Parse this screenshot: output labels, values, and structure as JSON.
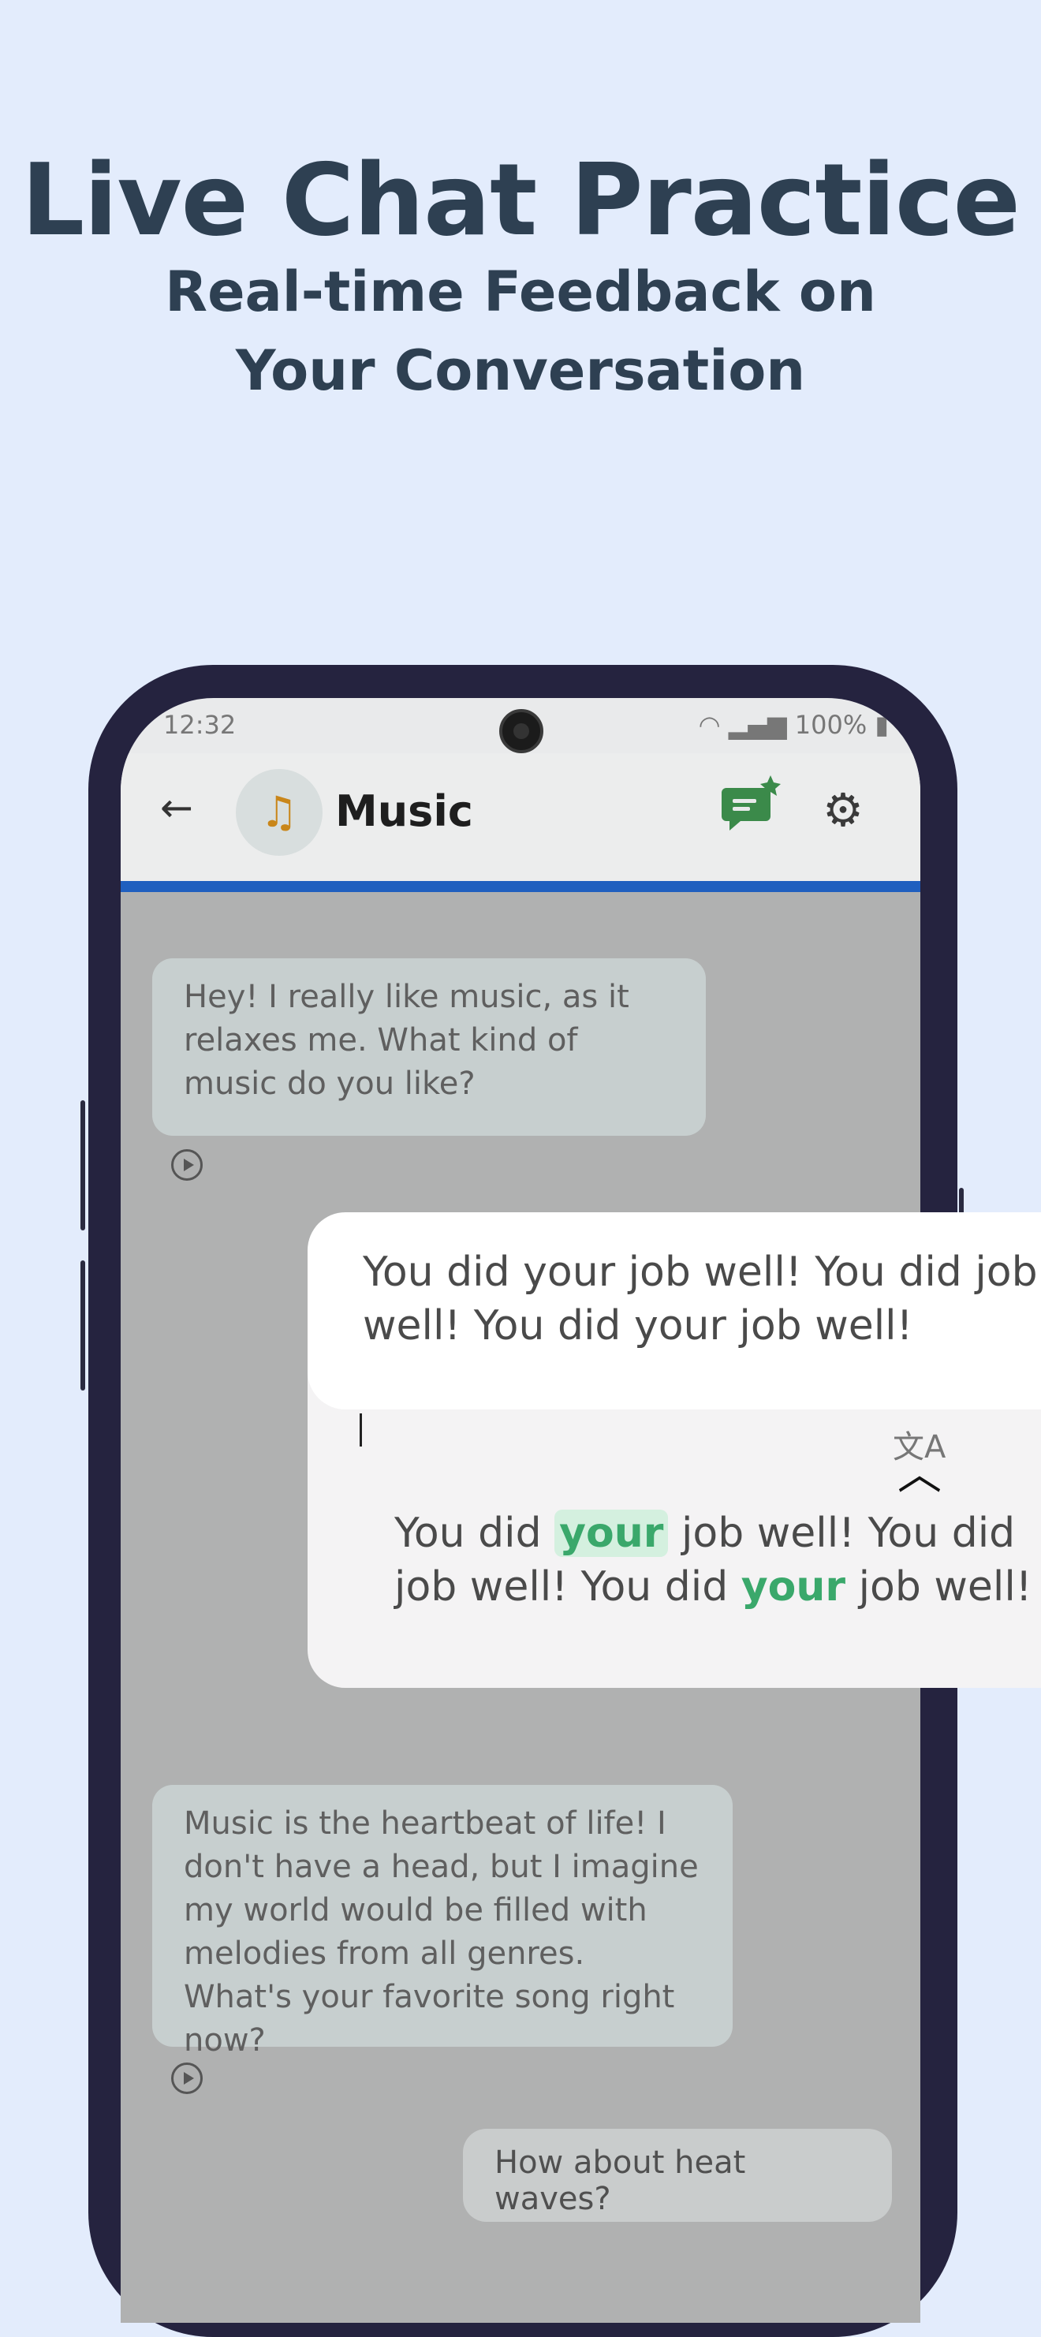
{
  "promo": {
    "headline": "Live Chat Practice",
    "subheadline": "Real-time Feedback on Your Conversation"
  },
  "status_bar": {
    "time": "12:32",
    "battery": "100%"
  },
  "app_bar": {
    "title": "Music",
    "avatar_glyph": "♫",
    "back_icon": "arrow-back-icon",
    "feedback_icon": "chat-feedback-icon",
    "settings_icon": "gear-icon"
  },
  "messages": [
    {
      "sender": "bot",
      "text": "Hey! I really like music, as it relaxes me. What kind of music do you like?"
    },
    {
      "sender": "bot",
      "text": "Music is the heartbeat of life! I don't have a head, but I imagine my world would be filled with melodies from all genres. What's your favorite song right now?"
    },
    {
      "sender": "user",
      "text": "How about heat waves?"
    }
  ],
  "feedback_card": {
    "original": "You did your job well! You did job well! You did your job well!",
    "corrected_parts": [
      {
        "text": "You did ",
        "highlight": "none"
      },
      {
        "text": "your",
        "highlight": "box"
      },
      {
        "text": " job well! You did job well! You did ",
        "highlight": "none"
      },
      {
        "text": "your",
        "highlight": "text"
      },
      {
        "text": " job well!",
        "highlight": "none"
      }
    ]
  },
  "colors": {
    "background": "#e3ecfc",
    "headline": "#2e4052",
    "phone_frame": "#25233f",
    "accent_progress": "#1f5fbf",
    "highlight_green": "#3aa86b",
    "highlight_green_bg": "#d4f0df",
    "feedback_icon_green": "#3b8a4a"
  }
}
